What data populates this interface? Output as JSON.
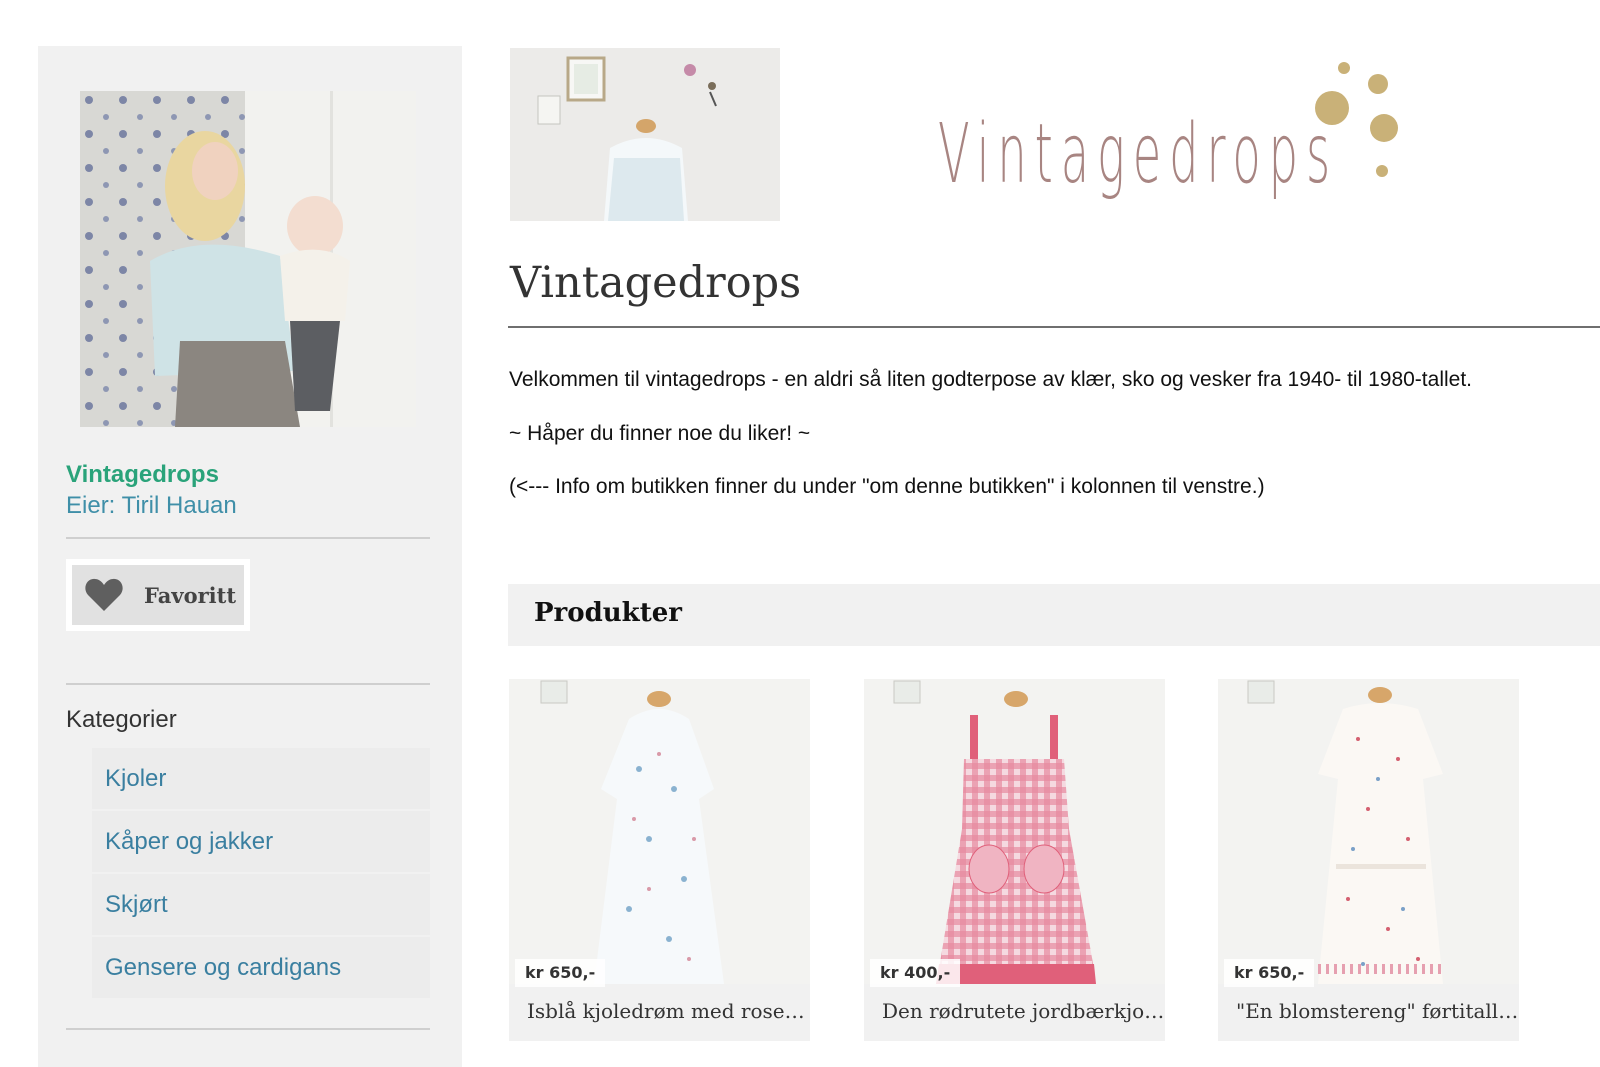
{
  "sidebar": {
    "shop_name": "Vintagedrops",
    "owner": "Eier: Tiril Hauan",
    "favorite_label": "Favoritt",
    "categories_title": "Kategorier",
    "categories": [
      "Kjoler",
      "Kåper og jakker",
      "Skjørt",
      "Gensere og cardigans"
    ]
  },
  "header": {
    "logo_text": "Vintagedrops",
    "title": "Vintagedrops"
  },
  "description": [
    "Velkommen til vintagedrops - en aldri så liten godterpose av klær, sko og vesker fra 1940- til 1980-tallet.",
    "~ Håper du finner noe du liker! ~",
    "(<--- Info om butikken finner du under \"om denne butikken\" i kolonnen til venstre.)"
  ],
  "products": {
    "heading": "Produkter",
    "items": [
      {
        "price": "kr 650,-",
        "title": "Isblå kjoledrøm med rosekvister"
      },
      {
        "price": "kr 400,-",
        "title": "Den rødrutete jordbærkjolen"
      },
      {
        "price": "kr 650,-",
        "title": "\"En blomstereng\" førtitallskjole"
      }
    ]
  },
  "colors": {
    "accent_green": "#2aa37a",
    "link_blue": "#3a7fa0",
    "logo_mauve": "#a88582",
    "logo_gold": "#c9b178"
  }
}
